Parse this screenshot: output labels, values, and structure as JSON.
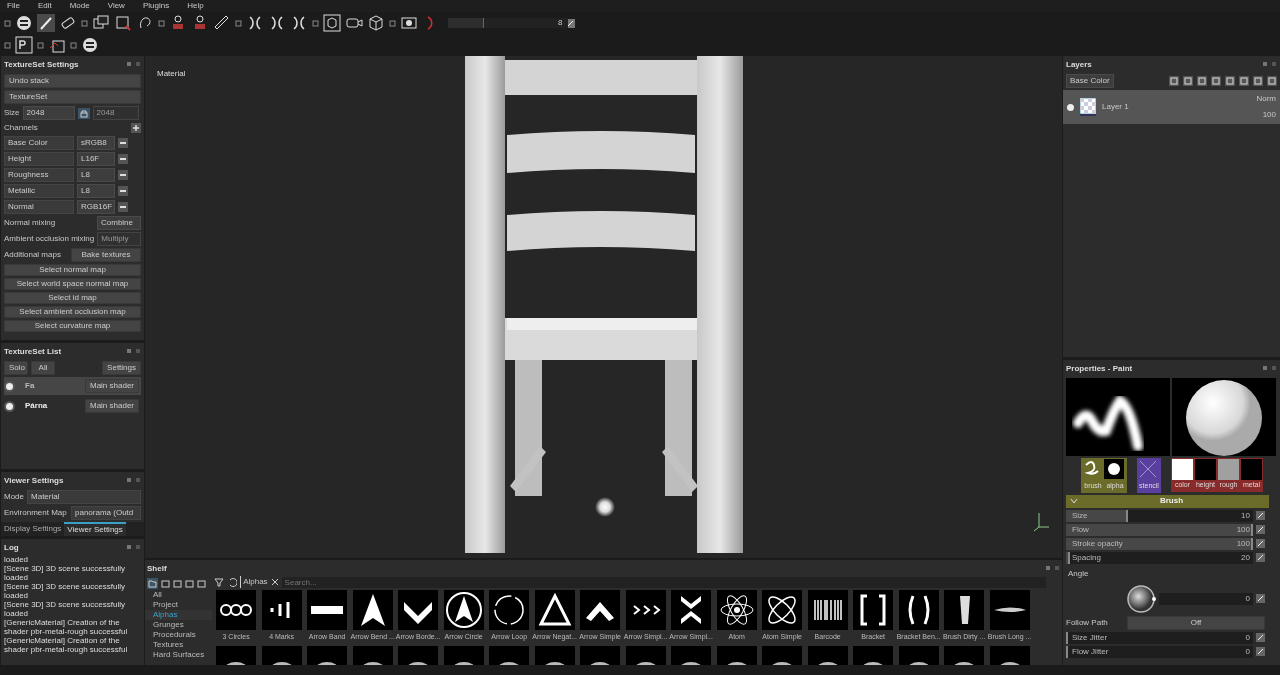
{
  "menu": [
    "File",
    "Edit",
    "Mode",
    "View",
    "Plugins",
    "Help"
  ],
  "toolbar": {
    "slider_value": "8",
    "level": 0.3
  },
  "texture_set_settings": {
    "title": "TextureSet Settings",
    "buttons": [
      "Undo stack",
      "TextureSet"
    ],
    "size": {
      "label": "Size",
      "value": "2048",
      "linked_value": "2048"
    },
    "channels_label": "Channels",
    "channels": [
      {
        "name": "Base Color",
        "format": "sRGB8"
      },
      {
        "name": "Height",
        "format": "L16F"
      },
      {
        "name": "Roughness",
        "format": "L8"
      },
      {
        "name": "Metallic",
        "format": "L8"
      },
      {
        "name": "Normal",
        "format": "RGB16F"
      }
    ],
    "options": [
      {
        "label": "Normal mixing",
        "value": "Combine",
        "disabled": false
      },
      {
        "label": "Ambient occlusion mixing",
        "value": "Multiply",
        "disabled": true
      }
    ],
    "additional_maps": {
      "label": "Additional maps",
      "button": "Bake textures"
    },
    "map_buttons": [
      "Select normal map",
      "Select world space normal map",
      "Select id map",
      "Select ambient occlusion map",
      "Select curvature map"
    ]
  },
  "texture_set_list": {
    "title": "TextureSet List",
    "buttons": [
      "Solo",
      "All"
    ],
    "settings_button": "Settings",
    "items": [
      {
        "name": "Fa",
        "shader": "Main shader",
        "selected": true
      },
      {
        "name": "Párna",
        "shader": "Main shader",
        "selected": false
      }
    ]
  },
  "viewer_settings": {
    "title": "Viewer Settings",
    "fields": [
      {
        "label": "Mode",
        "value": "Material"
      },
      {
        "label": "Environment Map",
        "value": "panorama (Outd"
      }
    ],
    "tabs": [
      {
        "label": "Display Settings",
        "selected": false
      },
      {
        "label": "Viewer Settings",
        "selected": true
      }
    ]
  },
  "log": {
    "title": "Log",
    "lines": [
      "loaded",
      "[Scene 3D] 3D scene successfully loaded",
      "[Scene 3D] 3D scene successfully loaded",
      "[Scene 3D] 3D scene successfully loaded",
      "[GenericMaterial] Creation of the shader pbr-metal-rough successful",
      "[GenericMaterial] Creation of the shader pbr-metal-rough successful"
    ]
  },
  "viewport": {
    "label": "Material"
  },
  "shelf": {
    "title": "Shelf",
    "categories": [
      {
        "label": "All",
        "selected": false
      },
      {
        "label": "Project",
        "selected": false
      },
      {
        "label": "Alphas",
        "selected": true
      },
      {
        "label": "Grunges",
        "selected": false
      },
      {
        "label": "Procedurals",
        "selected": false
      },
      {
        "label": "Textures",
        "selected": false
      },
      {
        "label": "Hard Surfaces",
        "selected": false
      }
    ],
    "filter_tag": "Alphas",
    "search": {
      "placeholder": "Search..."
    },
    "items": [
      "3 Circles",
      "4 Marks",
      "Arrow Band",
      "Arrow Bend ...",
      "Arrow Borde...",
      "Arrow Circle",
      "Arrow Loop",
      "Arrow Negat...",
      "Arrow Simple",
      "Arrow Simpl...",
      "Arrow Simpl...",
      "Atom",
      "Atom Simple",
      "Barcode",
      "Bracket",
      "Bracket Ben...",
      "Brush Dirty ...",
      "Brush Long ..."
    ]
  },
  "layers": {
    "title": "Layers",
    "channel": "Base Color",
    "items": [
      {
        "name": "Layer 1",
        "blend": "Norm",
        "opacity": "100",
        "selected": true
      }
    ]
  },
  "properties": {
    "title": "Properties - Paint",
    "slots": [
      "brush",
      "alpha",
      "stencil"
    ],
    "material_channels": [
      {
        "label": "color",
        "color": "#ffffff"
      },
      {
        "label": "height",
        "color": "#000000"
      },
      {
        "label": "rough",
        "color": "#a0a0a0"
      },
      {
        "label": "metal",
        "color": "#000000"
      }
    ],
    "section": "Brush",
    "params": [
      {
        "kind": "slider",
        "label": "Size",
        "value": "10",
        "level": 0.33
      },
      {
        "kind": "slider",
        "label": "Flow",
        "value": "100",
        "level": 1
      },
      {
        "kind": "slider",
        "label": "Stroke opacity",
        "value": "100",
        "level": 1
      },
      {
        "kind": "slider",
        "label": "Spacing",
        "value": "20",
        "level": 0.02
      },
      {
        "kind": "angle",
        "label": "Angle",
        "value": "0"
      },
      {
        "kind": "toggle",
        "label": "Follow Path",
        "value": "Off"
      },
      {
        "kind": "slider",
        "label": "Size Jitter",
        "value": "0",
        "level": 0
      },
      {
        "kind": "slider",
        "label": "Flow Jitter",
        "value": "0",
        "level": 0
      }
    ]
  }
}
